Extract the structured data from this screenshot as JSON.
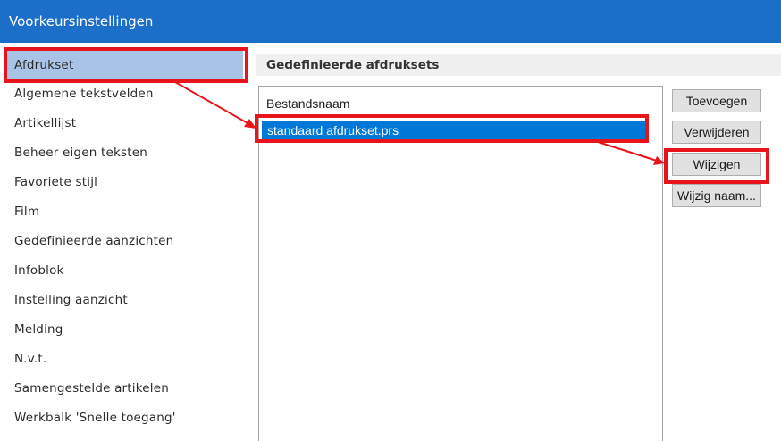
{
  "window": {
    "title": "Voorkeursinstellingen"
  },
  "sidebar": {
    "items": [
      {
        "label": "Afdrukset",
        "selected": true
      },
      {
        "label": "Algemene tekstvelden"
      },
      {
        "label": "Artikellijst"
      },
      {
        "label": "Beheer eigen teksten"
      },
      {
        "label": "Favoriete stijl"
      },
      {
        "label": "Film"
      },
      {
        "label": "Gedefinieerde aanzichten"
      },
      {
        "label": "Infoblok"
      },
      {
        "label": "Instelling aanzicht"
      },
      {
        "label": "Melding"
      },
      {
        "label": "N.v.t."
      },
      {
        "label": "Samengestelde artikelen"
      },
      {
        "label": "Werkbalk 'Snelle toegang'"
      }
    ]
  },
  "main": {
    "section_title": "Gedefinieerde afdruksets",
    "list": {
      "column_header": "Bestandsnaam",
      "rows": [
        {
          "name": "standaard afdrukset.prs",
          "selected": true
        }
      ]
    },
    "buttons": {
      "add": "Toevoegen",
      "remove": "Verwijderen",
      "edit": "Wijzigen",
      "rename": "Wijzig naam..."
    }
  },
  "colors": {
    "titlebar": "#1b6fc8",
    "selection": "#0078d7",
    "sidebar_selection": "#a9c3e6",
    "annotation": "#e8141c"
  }
}
